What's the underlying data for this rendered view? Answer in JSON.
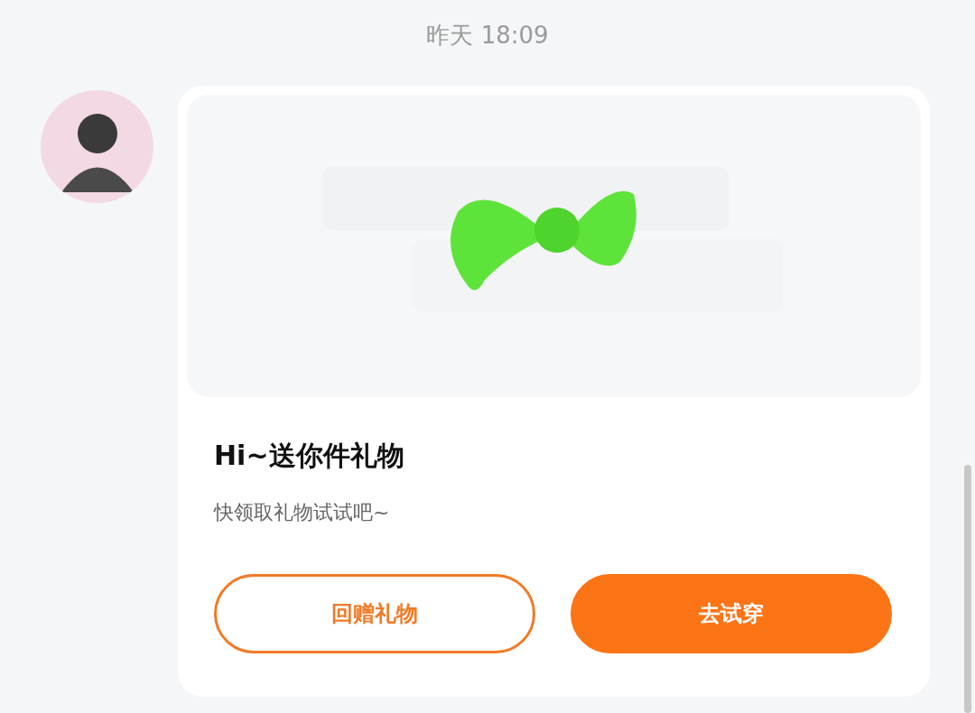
{
  "timestamp": "昨天 18:09",
  "message": {
    "title": "Hi~送你件礼物",
    "subtitle": "快领取礼物试试吧~",
    "buttons": [
      {
        "label": "回赠礼物",
        "kind": "outline"
      },
      {
        "label": "去试穿",
        "kind": "filled"
      }
    ]
  }
}
